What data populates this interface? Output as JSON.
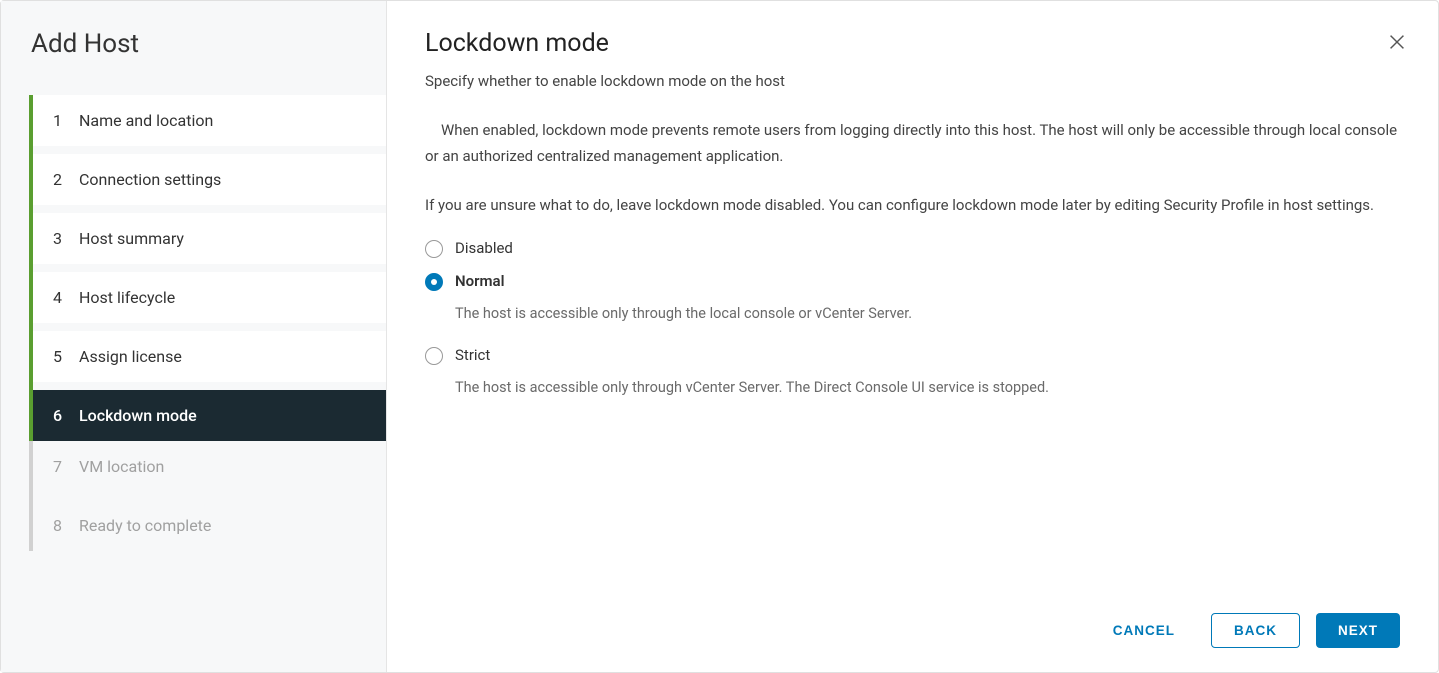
{
  "wizard": {
    "title": "Add Host",
    "steps": [
      {
        "num": "1",
        "label": "Name and location",
        "state": "done"
      },
      {
        "num": "2",
        "label": "Connection settings",
        "state": "done"
      },
      {
        "num": "3",
        "label": "Host summary",
        "state": "done"
      },
      {
        "num": "4",
        "label": "Host lifecycle",
        "state": "done"
      },
      {
        "num": "5",
        "label": "Assign license",
        "state": "done"
      },
      {
        "num": "6",
        "label": "Lockdown mode",
        "state": "active"
      },
      {
        "num": "7",
        "label": "VM location",
        "state": "future"
      },
      {
        "num": "8",
        "label": "Ready to complete",
        "state": "future"
      }
    ]
  },
  "page": {
    "title": "Lockdown mode",
    "subtitle": "Specify whether to enable lockdown mode on the host",
    "description": "When enabled, lockdown mode prevents remote users from logging directly into this host. The host will only be accessible through local console or an authorized centralized management application.",
    "hint": "If you are unsure what to do, leave lockdown mode disabled. You can configure lockdown mode later by editing Security Profile in host settings."
  },
  "options": {
    "disabled": {
      "label": "Disabled"
    },
    "normal": {
      "label": "Normal",
      "help": "The host is accessible only through the local console or vCenter Server."
    },
    "strict": {
      "label": "Strict",
      "help": "The host is accessible only through vCenter Server. The Direct Console UI service is stopped."
    },
    "selected": "normal"
  },
  "buttons": {
    "cancel": "CANCEL",
    "back": "BACK",
    "next": "NEXT"
  }
}
